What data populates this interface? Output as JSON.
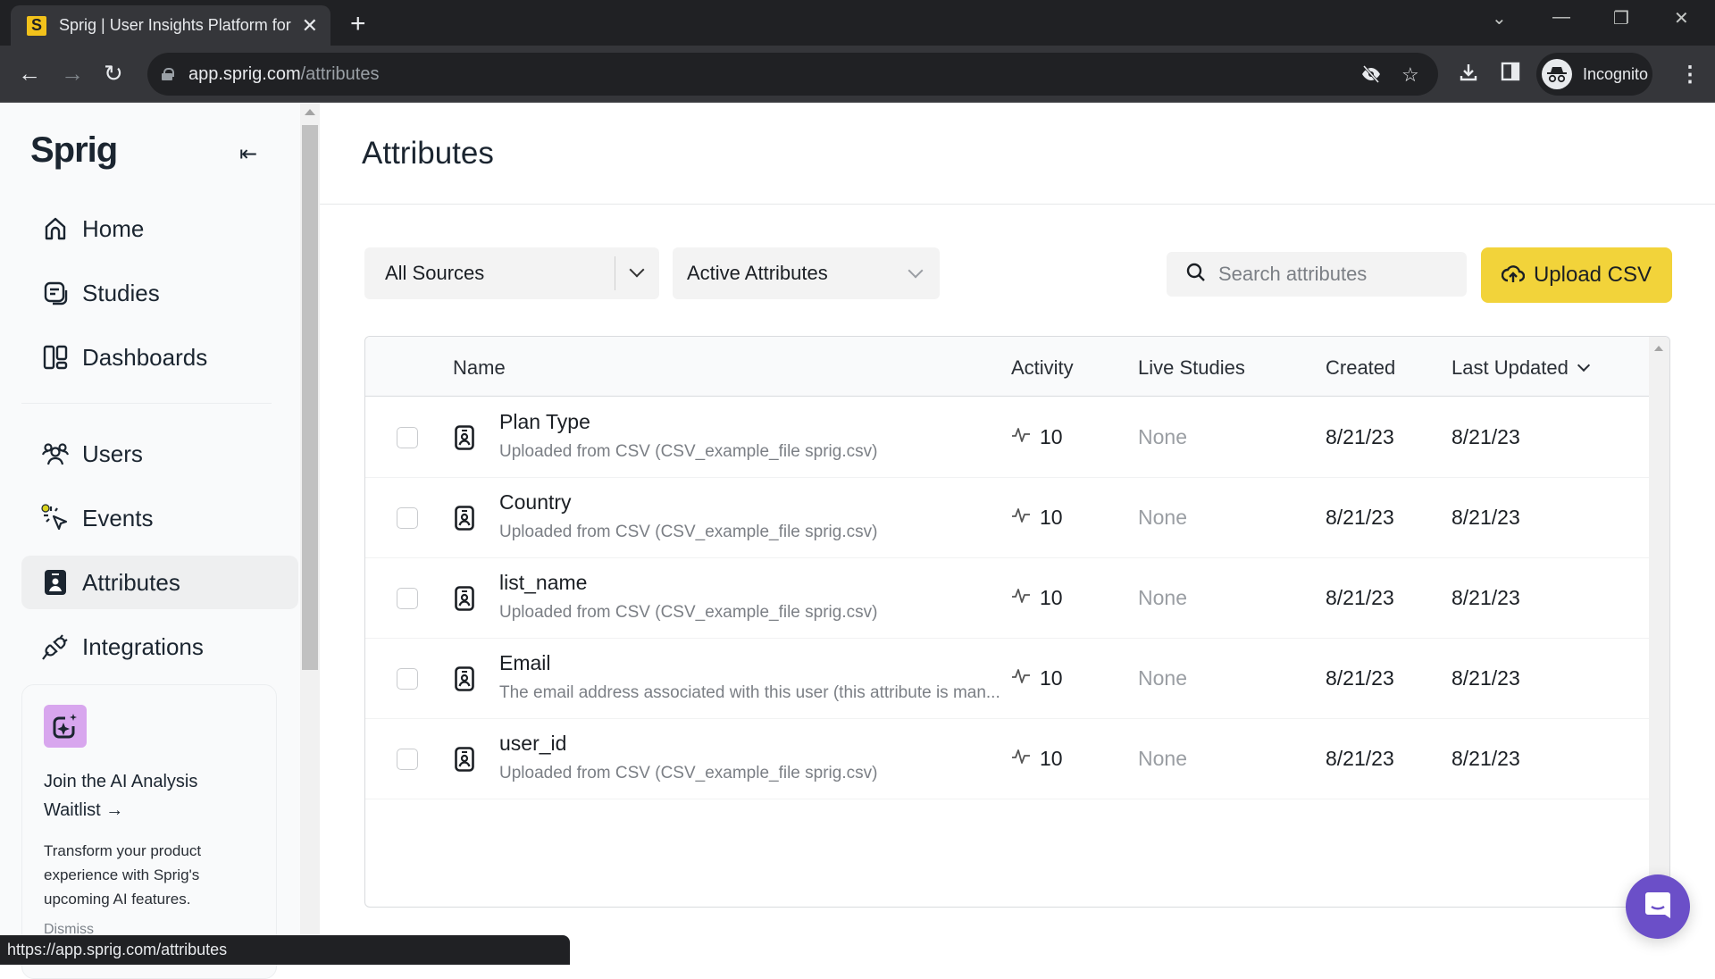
{
  "browser": {
    "tab_title": "Sprig | User Insights Platform for",
    "favicon_letter": "S",
    "url_host": "app.sprig.com",
    "url_path": "/attributes",
    "profile_label": "Incognito",
    "status_url": "https://app.sprig.com/attributes"
  },
  "sidebar": {
    "logo": "Sprig",
    "items": [
      {
        "label": "Home",
        "icon": "home-icon"
      },
      {
        "label": "Studies",
        "icon": "studies-icon"
      },
      {
        "label": "Dashboards",
        "icon": "dashboards-icon"
      },
      {
        "label": "Users",
        "icon": "users-icon"
      },
      {
        "label": "Events",
        "icon": "events-icon"
      },
      {
        "label": "Attributes",
        "icon": "attributes-icon",
        "active": true
      },
      {
        "label": "Integrations",
        "icon": "integrations-icon"
      }
    ],
    "promo": {
      "title": "Join the AI Analysis Waitlist →",
      "text": "Transform your product experience with Sprig's upcoming AI features.",
      "dismiss": "Dismiss"
    }
  },
  "main": {
    "title": "Attributes",
    "source_filter": "All Sources",
    "status_filter": "Active Attributes",
    "search_placeholder": "Search attributes",
    "upload_label": "Upload CSV",
    "columns": [
      "Name",
      "Activity",
      "Live Studies",
      "Created",
      "Last Updated"
    ],
    "rows": [
      {
        "name": "Plan Type",
        "desc": "Uploaded from CSV (CSV_example_file sprig.csv)",
        "activity": "10",
        "live": "None",
        "created": "8/21/23",
        "updated": "8/21/23"
      },
      {
        "name": "Country",
        "desc": "Uploaded from CSV (CSV_example_file sprig.csv)",
        "activity": "10",
        "live": "None",
        "created": "8/21/23",
        "updated": "8/21/23"
      },
      {
        "name": "list_name",
        "desc": "Uploaded from CSV (CSV_example_file sprig.csv)",
        "activity": "10",
        "live": "None",
        "created": "8/21/23",
        "updated": "8/21/23"
      },
      {
        "name": "Email",
        "desc": "The email address associated with this user (this attribute is man...",
        "activity": "10",
        "live": "None",
        "created": "8/21/23",
        "updated": "8/21/23"
      },
      {
        "name": "user_id",
        "desc": "Uploaded from CSV (CSV_example_file sprig.csv)",
        "activity": "10",
        "live": "None",
        "created": "8/21/23",
        "updated": "8/21/23"
      }
    ]
  },
  "colors": {
    "accent": "#f2d33a",
    "chat": "#6b4fc8",
    "promo_icon_bg": "#d8a6ee"
  }
}
